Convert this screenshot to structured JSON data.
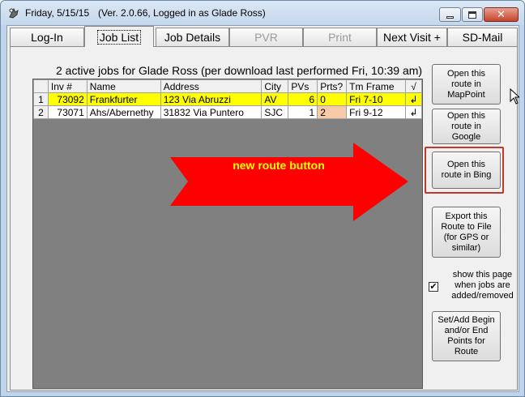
{
  "window": {
    "title": "Friday, 5/15/15",
    "version_info": "(Ver. 2.0.66, Logged in as Glade Ross)",
    "close_glyph": "✕"
  },
  "tabs": [
    {
      "label": "Log-In",
      "state": "normal"
    },
    {
      "label": "Job List",
      "state": "active"
    },
    {
      "label": "Job Details",
      "state": "normal"
    },
    {
      "label": "PVR",
      "state": "disabled"
    },
    {
      "label": "Print",
      "state": "disabled"
    },
    {
      "label": "Next Visit +",
      "state": "normal"
    },
    {
      "label": "SD-Mail",
      "state": "normal"
    }
  ],
  "job_list": {
    "caption": "2 active jobs for Glade Ross (per download last performed Fri, 10:39 am)",
    "columns": [
      "Inv #",
      "Name",
      "Address",
      "City",
      "PVs",
      "Prts?",
      "Tm Frame",
      "√"
    ],
    "rows": [
      {
        "row_num": "1",
        "inv": "73092",
        "name": "Frankfurter",
        "address": "123 Via Abruzzi",
        "city": "AV",
        "pvs": "6",
        "prts": "0",
        "tm_frame": "Fri 7-10",
        "mark": "↲"
      },
      {
        "row_num": "2",
        "inv": "73071",
        "name": "Ahs/Abernethy",
        "address": "31832 Via Puntero",
        "city": "SJC",
        "pvs": "1",
        "prts": "2",
        "tm_frame": "Fri 9-12",
        "mark": "↲"
      }
    ]
  },
  "annotation": {
    "label": "new route button",
    "arrow_color": "#ff0000",
    "label_color": "#ffff00",
    "highlight_color": "#c0392b"
  },
  "side_buttons": {
    "mappoint": "Open this route in MapPoint",
    "google": "Open this route in Google",
    "bing": "Open this route in Bing",
    "export": "Export this Route to File (for GPS or similar)",
    "set_points": "Set/Add Begin and/or End Points for Route"
  },
  "show_page_option": {
    "label": "show this page when jobs are added/removed",
    "checked": true,
    "check_glyph": "✔"
  },
  "colors": {
    "selected_row": "#ffff00",
    "parts_highlight": "#f7cba7",
    "grid_background": "#808080",
    "titlebar": "#c4d7ec"
  }
}
